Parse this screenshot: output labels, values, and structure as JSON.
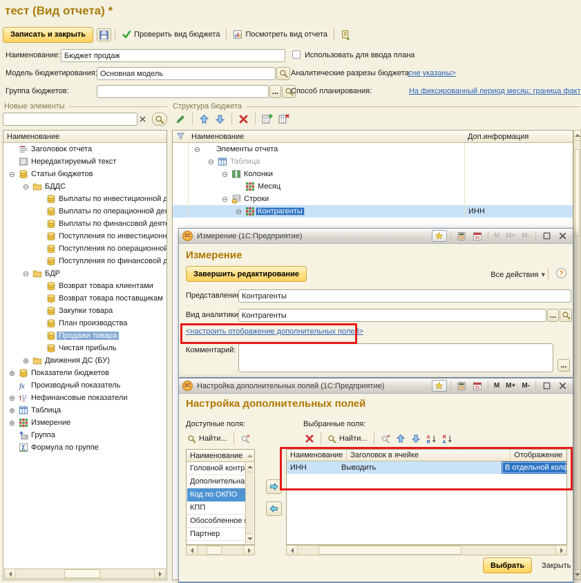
{
  "chrome": {
    "product": "1С",
    "memory": [
      "M",
      "M+",
      "M-"
    ],
    "ellipsis": "...",
    "all_actions_arrow": "▾"
  },
  "window": {
    "title": "тест (Вид отчета) *"
  },
  "toolbar": {
    "save_close": "Записать и закрыть",
    "check": "Проверить вид бюджета",
    "preview": "Посмотреть вид отчета"
  },
  "form": {
    "name_label": "Наименование:",
    "name_value": "Бюджет продаж",
    "use_plan_label": "Использовать для ввода плана",
    "model_label": "Модель бюджетирования:",
    "model_value": "Основная модель",
    "cuts_label": "Аналитические разрезы бюджета:",
    "cuts_link": "<не указаны>",
    "group_label": "Группа бюджетов:",
    "group_value": "",
    "planning_label": "Способ планирования:",
    "planning_link": "На фиксированный период месяц;  граница факт"
  },
  "left_panel": {
    "title": "Новые элементы",
    "search_value": "",
    "tree_header": "Наименование",
    "items": [
      {
        "label": "Заголовок отчета",
        "icon": "report-title",
        "level": 0
      },
      {
        "label": "Нередактируемый текст",
        "icon": "static-text",
        "level": 0
      },
      {
        "label": "Статьи бюджетов",
        "icon": "coins",
        "level": 0,
        "exp": "minus"
      },
      {
        "label": "БДДС",
        "icon": "folder",
        "level": 1,
        "exp": "minus"
      },
      {
        "label": "Выплаты по инвестиционной д",
        "icon": "coins",
        "level": 2
      },
      {
        "label": "Выплаты по операционной дея",
        "icon": "coins",
        "level": 2
      },
      {
        "label": "Выплаты по финансовой деяте",
        "icon": "coins",
        "level": 2
      },
      {
        "label": "Поступления по инвестиционн",
        "icon": "coins",
        "level": 2
      },
      {
        "label": "Поступления по операционной",
        "icon": "coins",
        "level": 2
      },
      {
        "label": "Поступления по финансовой д",
        "icon": "coins",
        "level": 2
      },
      {
        "label": "БДР",
        "icon": "folder",
        "level": 1,
        "exp": "minus"
      },
      {
        "label": "Возврат товара клиентами",
        "icon": "coins",
        "level": 2
      },
      {
        "label": "Возврат товара поставщикам",
        "icon": "coins",
        "level": 2
      },
      {
        "label": "Закупки товара",
        "icon": "coins",
        "level": 2
      },
      {
        "label": "План производства",
        "icon": "coins",
        "level": 2
      },
      {
        "label": "Продажи товара",
        "icon": "coins",
        "level": 2,
        "selected": true
      },
      {
        "label": "Чистая прибыль",
        "icon": "coins",
        "level": 2
      },
      {
        "label": "Движения ДС (БУ)",
        "icon": "folder",
        "level": 1,
        "exp": "plus"
      },
      {
        "label": "Показатели бюджетов",
        "icon": "coins",
        "level": 0,
        "exp": "plus"
      },
      {
        "label": "Производный показатель",
        "icon": "fx",
        "level": 0
      },
      {
        "label": "Нефинансовые показатели",
        "icon": "num123",
        "level": 0,
        "exp": "plus"
      },
      {
        "label": "Таблица",
        "icon": "table",
        "level": 0,
        "exp": "plus"
      },
      {
        "label": "Измерение",
        "icon": "dimension",
        "level": 0,
        "exp": "plus"
      },
      {
        "label": "Группа",
        "icon": "group",
        "level": 0
      },
      {
        "label": "Формула по группе",
        "icon": "sigma",
        "level": 0
      }
    ]
  },
  "structure_panel": {
    "title": "Структура бюджета",
    "col_name": "Наименование",
    "col_extra": "Доп.информация",
    "rows": [
      {
        "label": "Элементы отчета",
        "level": 0,
        "exp": "minus",
        "extra": ""
      },
      {
        "label": "Таблица",
        "icon": "table",
        "level": 1,
        "exp": "minus",
        "gray": true,
        "extra": ""
      },
      {
        "label": "Колонки",
        "icon": "columns",
        "level": 2,
        "exp": "minus",
        "extra": ""
      },
      {
        "label": "Месяц",
        "icon": "dimension",
        "level": 3,
        "extra": ""
      },
      {
        "label": "Строки",
        "icon": "rows",
        "level": 2,
        "exp": "minus",
        "extra": ""
      },
      {
        "label": "Контрагенты",
        "icon": "dimension",
        "level": 3,
        "exp": "minus",
        "selected": true,
        "extra": "ИНН"
      }
    ]
  },
  "dim_dialog": {
    "titlebar": "Измерение  (1С:Предприятие)",
    "heading": "Измерение",
    "finish_button": "Завершить редактирование",
    "all_actions": "Все действия",
    "view_label": "Представление:",
    "view_value": "Контрагенты",
    "analytics_label": "Вид аналитики:",
    "analytics_value": "Контрагенты",
    "fields_link": "<настроить отображение дополнительных полей>",
    "comment_label": "Комментарий:",
    "comment_value": ""
  },
  "fields_dialog": {
    "titlebar": "Настройка дополнительных полей  (1С:Предприятие)",
    "heading": "Настройка дополнительных полей",
    "available_label": "Доступные поля:",
    "selected_label": "Выбранные поля:",
    "find_button": "Найти...",
    "available_header": "Наименование",
    "available_items": [
      {
        "label": "Головной контраген"
      },
      {
        "label": "Дополнительная ин"
      },
      {
        "label": "Код по ОКПО",
        "selected": true
      },
      {
        "label": "КПП"
      },
      {
        "label": "Обособленное подр"
      },
      {
        "label": "Партнер"
      }
    ],
    "selected_columns": [
      "Наименование",
      "Заголовок в ячейке",
      "Отображение"
    ],
    "selected_rows": [
      [
        "ИНН",
        "Выводить",
        "В отдельной колонке"
      ]
    ],
    "choose_button": "Выбрать",
    "close_button": "Закрыть"
  },
  "colors": {
    "accent_orange": "#B07800",
    "button_face": "#FFE18A",
    "link_blue": "#2A62B8",
    "selection_strong": "#2E74C4",
    "selection_row": "#C9E2F8",
    "annotation_red": "#E81A1A"
  }
}
